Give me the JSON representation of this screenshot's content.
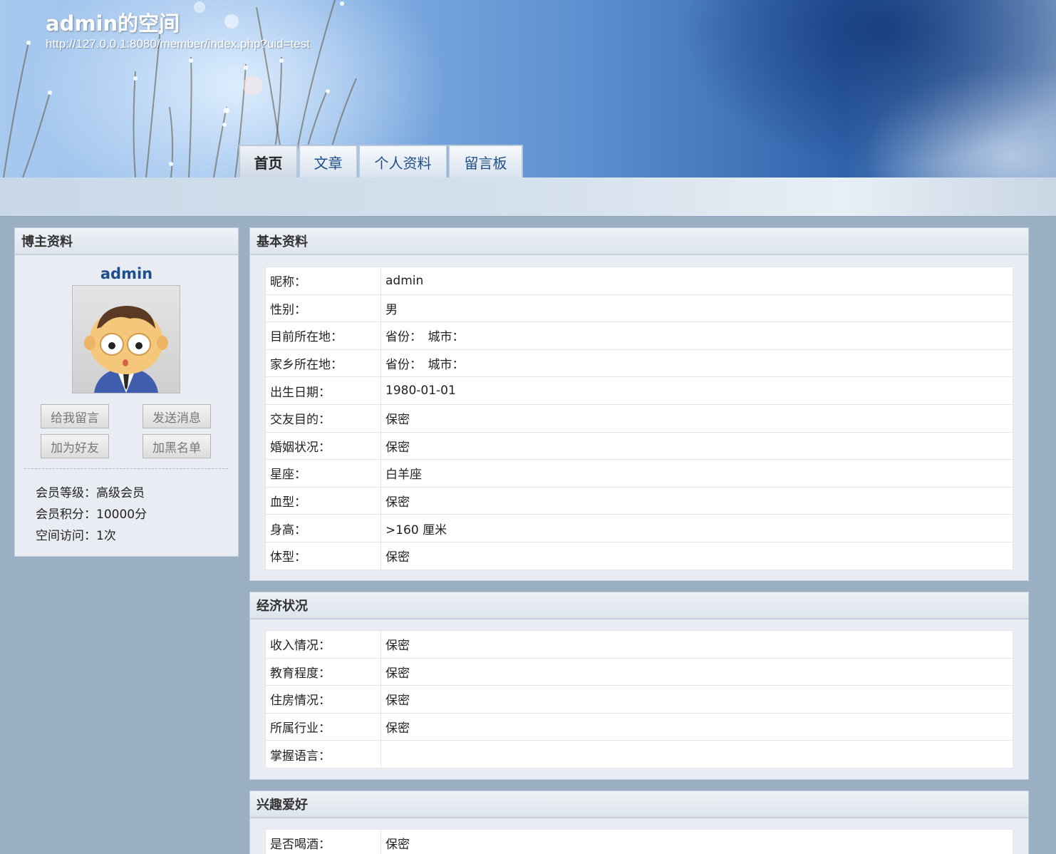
{
  "header": {
    "title": "admin的空间",
    "url": "http://127.0.0.1:8080/member/index.php?uid=test"
  },
  "nav": {
    "tabs": [
      {
        "label": "首页",
        "active": true
      },
      {
        "label": "文章",
        "active": false
      },
      {
        "label": "个人资料",
        "active": false
      },
      {
        "label": "留言板",
        "active": false
      }
    ]
  },
  "sidebar": {
    "title": "博主资料",
    "username": "admin",
    "buttons": {
      "leave_message": "给我留言",
      "send_message": "发送消息",
      "add_friend": "加为好友",
      "blacklist": "加黑名单"
    },
    "stats": {
      "level": "会员等级：高级会员",
      "points": "会员积分：10000分",
      "visits": "空间访问：1次"
    }
  },
  "basic": {
    "title": "基本资料",
    "rows": [
      {
        "label": "昵称：",
        "value": "admin"
      },
      {
        "label": "性别：",
        "value": "男"
      },
      {
        "label": "目前所在地：",
        "value": "省份：　城市："
      },
      {
        "label": "家乡所在地：",
        "value": "省份：　城市："
      },
      {
        "label": "出生日期：",
        "value": "1980-01-01"
      },
      {
        "label": "交友目的：",
        "value": "保密"
      },
      {
        "label": "婚姻状况：",
        "value": "保密"
      },
      {
        "label": "星座：",
        "value": "白羊座"
      },
      {
        "label": "血型：",
        "value": "保密"
      },
      {
        "label": "身高：",
        "value": ">160 厘米"
      },
      {
        "label": "体型：",
        "value": "保密"
      }
    ]
  },
  "economy": {
    "title": "经济状况",
    "rows": [
      {
        "label": "收入情况：",
        "value": "保密"
      },
      {
        "label": "教育程度：",
        "value": "保密"
      },
      {
        "label": "住房情况：",
        "value": "保密"
      },
      {
        "label": "所属行业：",
        "value": "保密"
      },
      {
        "label": "掌握语言：",
        "value": ""
      }
    ]
  },
  "hobbies": {
    "title": "兴趣爱好",
    "rows": [
      {
        "label": "是否喝酒：",
        "value": "保密"
      }
    ]
  },
  "icons": {
    "avatar": "cartoon-man-avatar-icon"
  }
}
